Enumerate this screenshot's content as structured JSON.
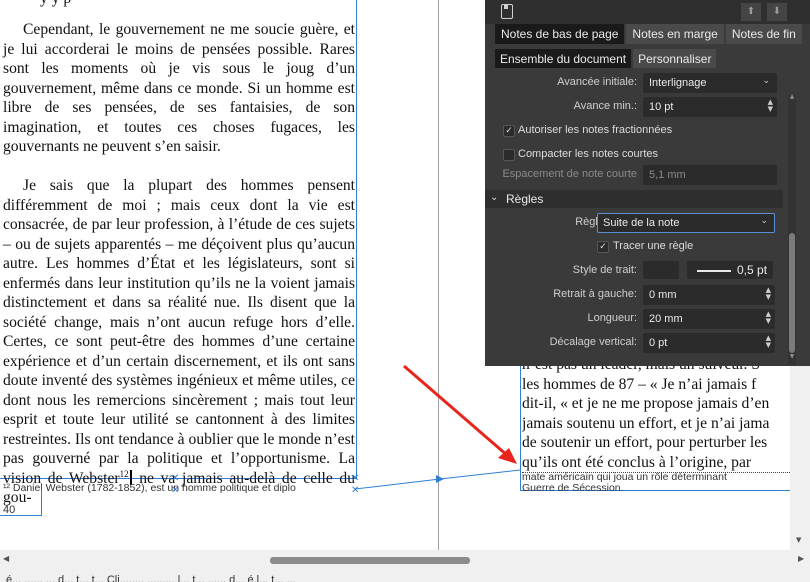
{
  "document": {
    "top_fragment": "y  y p",
    "left_paragraphs": [
      "Cependant, le gouvernement ne me soucie guère, et je lui accorderai le moins de pensées possible. Rares sont les moments où je vis sous le joug d’un gouvernement, même dans ce monde. Si un homme est libre de ses pensées, de ses fantaisies, de son imagination, et toutes ces choses fugaces, les gouvernants ne peuvent s’en saisir.",
      "Je sais que la plupart des hommes pensent différemment de moi ; mais ceux dont la vie est consacrée, de par leur profession, à l’étude de ces sujets – ou de sujets apparentés – me déçoivent plus qu’aucun autre. Les hommes d’État et les législateurs, sont si enfermés dans leur institution qu’ils ne la voient jamais distinctement et dans sa réalité nue. Ils disent que la société change, mais n’ont aucun refuge hors d’elle. Certes, ce sont peut-être des hommes d’une certaine expérience et d’un certain discernement, et ils ont sans doute inventé des systèmes ingénieux et même utiles, ce dont nous les remercions sincèrement ; mais tout leur esprit et toute leur utilité se cantonnent à des limites restreintes. Ils ont tendance à oublier que le monde n’est pas gouverné par la politique et l’opportunisme. La vision de Webster"
    ],
    "last_para_end": " ne va jamais au-delà de celle du gou-",
    "footnote_marker": "12",
    "footnote_left": "¹² Daniel Webster (1782-1852), est un homme politique et diplo",
    "page_number": "40",
    "right_lines": [
      "n’est pas un leader, mais un suiveur. S",
      "les hommes de 87 – « Je n’ai jamais f",
      "dit-il, « et je ne me propose jamais d’en",
      "jamais soutenu un effort, et je n’ai jama",
      "de soutenir un effort, pour perturber les",
      "qu’ils ont été conclus à l’origine, par"
    ],
    "footnote_right_lines": [
      "mate américain qui joua un rôle déterminant",
      "Guerre de Sécession."
    ]
  },
  "panel": {
    "tabs": [
      "Notes de bas de page",
      "Notes en marge",
      "Notes de fin"
    ],
    "subtabs": [
      "Ensemble du document",
      "Personnaliser"
    ],
    "rows": {
      "avance_initiale": {
        "label": "Avancée initiale:",
        "value": "Interlignage"
      },
      "avance_min": {
        "label": "Avance min.:",
        "value": "10 pt"
      },
      "autoriser": {
        "label": "Autoriser les notes fractionnées",
        "checked": true
      },
      "compacter": {
        "label": "Compacter les notes courtes",
        "checked": false
      },
      "espacement": {
        "label": "Espacement de note courte",
        "value": "5,1 mm"
      }
    },
    "section": {
      "title": "Règles"
    },
    "regles": {
      "regle_avant": {
        "label": "Règle avant:",
        "value": "Suite de la note"
      },
      "tracer": {
        "label": "Tracer une règle",
        "checked": true
      },
      "style_trait": {
        "label": "Style de trait:",
        "value": "0,5 pt"
      },
      "retrait": {
        "label": "Retrait à gauche:",
        "value": "0 mm"
      },
      "longueur": {
        "label": "Longueur:",
        "value": "20 mm"
      },
      "decalage": {
        "label": "Décalage vertical:",
        "value": "0 pt"
      }
    }
  },
  "status_bar": {
    "text": "é... ...... ... d... t... t... Cli........ ......... l... t... ...... d... é.l... t... ..."
  },
  "colors": {
    "panel_bg": "#3a3a3a",
    "frame_blue": "#2f7fd6",
    "annotation_arrow": "#e8241c"
  }
}
